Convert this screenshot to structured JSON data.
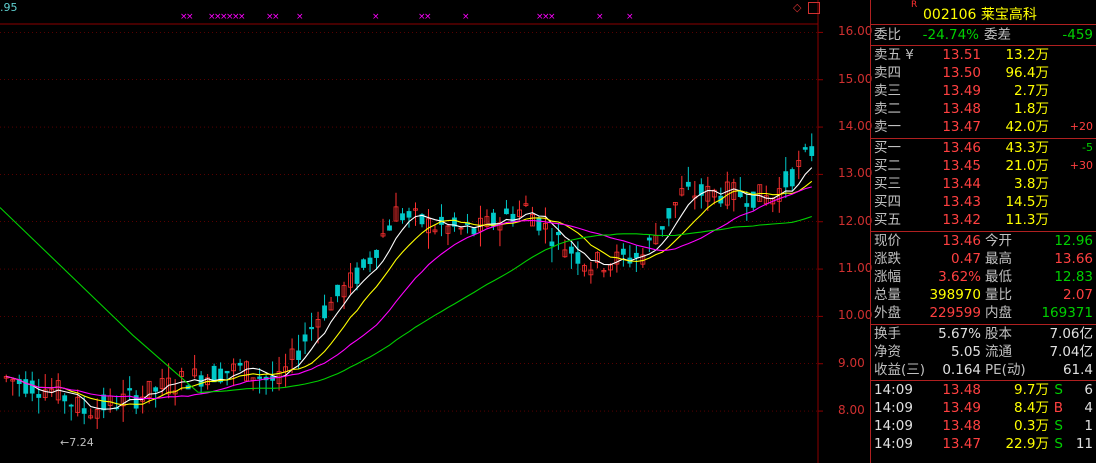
{
  "chart": {
    "corner_value": ".95",
    "y_axis_labels": [
      "16.00",
      "15.00",
      "14.00",
      "13.00",
      "12.00",
      "11.00",
      "10.00",
      "9.00",
      "8.00"
    ],
    "low_annotation": "←7.24",
    "y_range": [
      7.6,
      16.6
    ]
  },
  "colors": {
    "up": "#ff3030",
    "down": "#00c8c8",
    "ma5": "#ffffff",
    "ma10": "#ffff00",
    "ma20": "#ff00ff",
    "ma60": "#00d000",
    "grid": "#8b0000"
  },
  "quote": {
    "flag": "R",
    "code_name": "002106 莱宝高科",
    "weibi_label": "委比",
    "weibi_value": "-24.74%",
    "weicha_label": "委差",
    "weicha_value": "-459",
    "asks": [
      {
        "label": "卖五 ¥",
        "price": "13.51",
        "vol": "13.2万",
        "chg": ""
      },
      {
        "label": "卖四",
        "price": "13.50",
        "vol": "96.4万",
        "chg": ""
      },
      {
        "label": "卖三",
        "price": "13.49",
        "vol": "2.7万",
        "chg": ""
      },
      {
        "label": "卖二",
        "price": "13.48",
        "vol": "1.8万",
        "chg": ""
      },
      {
        "label": "卖一",
        "price": "13.47",
        "vol": "42.0万",
        "chg": "+20"
      }
    ],
    "bids": [
      {
        "label": "买一",
        "price": "13.46",
        "vol": "43.3万",
        "chg": "-5"
      },
      {
        "label": "买二",
        "price": "13.45",
        "vol": "21.0万",
        "chg": "+30"
      },
      {
        "label": "买三",
        "price": "13.44",
        "vol": "3.8万",
        "chg": ""
      },
      {
        "label": "买四",
        "price": "13.43",
        "vol": "14.5万",
        "chg": ""
      },
      {
        "label": "买五",
        "price": "13.42",
        "vol": "11.3万",
        "chg": ""
      }
    ],
    "stats": [
      {
        "l1": "现价",
        "v1": "13.46",
        "l2": "今开",
        "v2": "12.96"
      },
      {
        "l1": "涨跌",
        "v1": "0.47",
        "l2": "最高",
        "v2": "13.66"
      },
      {
        "l1": "涨幅",
        "v1": "3.62%",
        "l2": "最低",
        "v2": "12.83"
      },
      {
        "l1": "总量",
        "v1": "398970",
        "l2": "量比",
        "v2": "2.07"
      },
      {
        "l1": "外盘",
        "v1": "229599",
        "l2": "内盘",
        "v2": "169371"
      }
    ],
    "fund": [
      {
        "l1": "换手",
        "v1": "5.67%",
        "l2": "股本",
        "v2": "7.06亿"
      },
      {
        "l1": "净资",
        "v1": "5.05",
        "l2": "流通",
        "v2": "7.04亿"
      },
      {
        "l1": "收益(三)",
        "v1": "0.164",
        "l2": "PE(动)",
        "v2": "61.4"
      }
    ],
    "ticks": [
      {
        "time": "14:09",
        "price": "13.48",
        "vol": "9.7万",
        "side": "S",
        "n": "6"
      },
      {
        "time": "14:09",
        "price": "13.49",
        "vol": "8.4万",
        "side": "B",
        "n": "4"
      },
      {
        "time": "14:09",
        "price": "13.48",
        "vol": "0.3万",
        "side": "S",
        "n": "1"
      },
      {
        "time": "14:09",
        "price": "13.47",
        "vol": "22.9万",
        "side": "S",
        "n": "11"
      }
    ]
  }
}
